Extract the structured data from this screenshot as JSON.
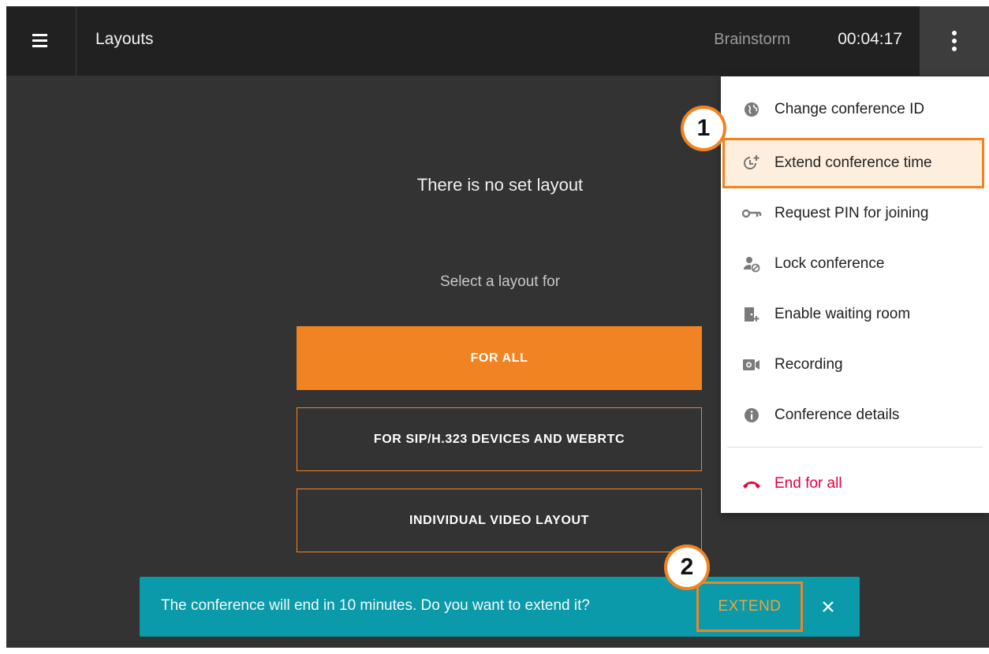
{
  "header": {
    "title": "Layouts",
    "conference_name": "Brainstorm",
    "timer": "00:04:17"
  },
  "main": {
    "no_layout_text": "There is no set layout",
    "select_label": "Select a layout for",
    "buttons": {
      "for_all": "FOR ALL",
      "sip_webrtc": "FOR SIP/H.323 DEVICES AND WEBRTC",
      "individual": "INDIVIDUAL VIDEO LAYOUT"
    }
  },
  "menu": {
    "items": [
      {
        "label": "Change conference ID",
        "icon": "globe-icon"
      },
      {
        "label": "Extend conference time",
        "icon": "clock-plus-icon"
      },
      {
        "label": "Request PIN for joining",
        "icon": "key-icon"
      },
      {
        "label": "Lock conference",
        "icon": "lock-user-icon"
      },
      {
        "label": "Enable waiting room",
        "icon": "door-enter-icon"
      },
      {
        "label": "Recording",
        "icon": "video-camera-icon"
      },
      {
        "label": "Conference details",
        "icon": "info-icon"
      }
    ],
    "end_for_all": "End for all"
  },
  "snackbar": {
    "message": "The conference will end in 10 minutes. Do you want to extend it?",
    "action": "EXTEND"
  },
  "callouts": {
    "step1": "1",
    "step2": "2"
  },
  "colors": {
    "accent": "#f28322",
    "topbar": "#212121",
    "background": "#333333",
    "snackbar": "#0b9aa9",
    "danger": "#e8003d",
    "highlight_fill": "#fdeedd"
  }
}
